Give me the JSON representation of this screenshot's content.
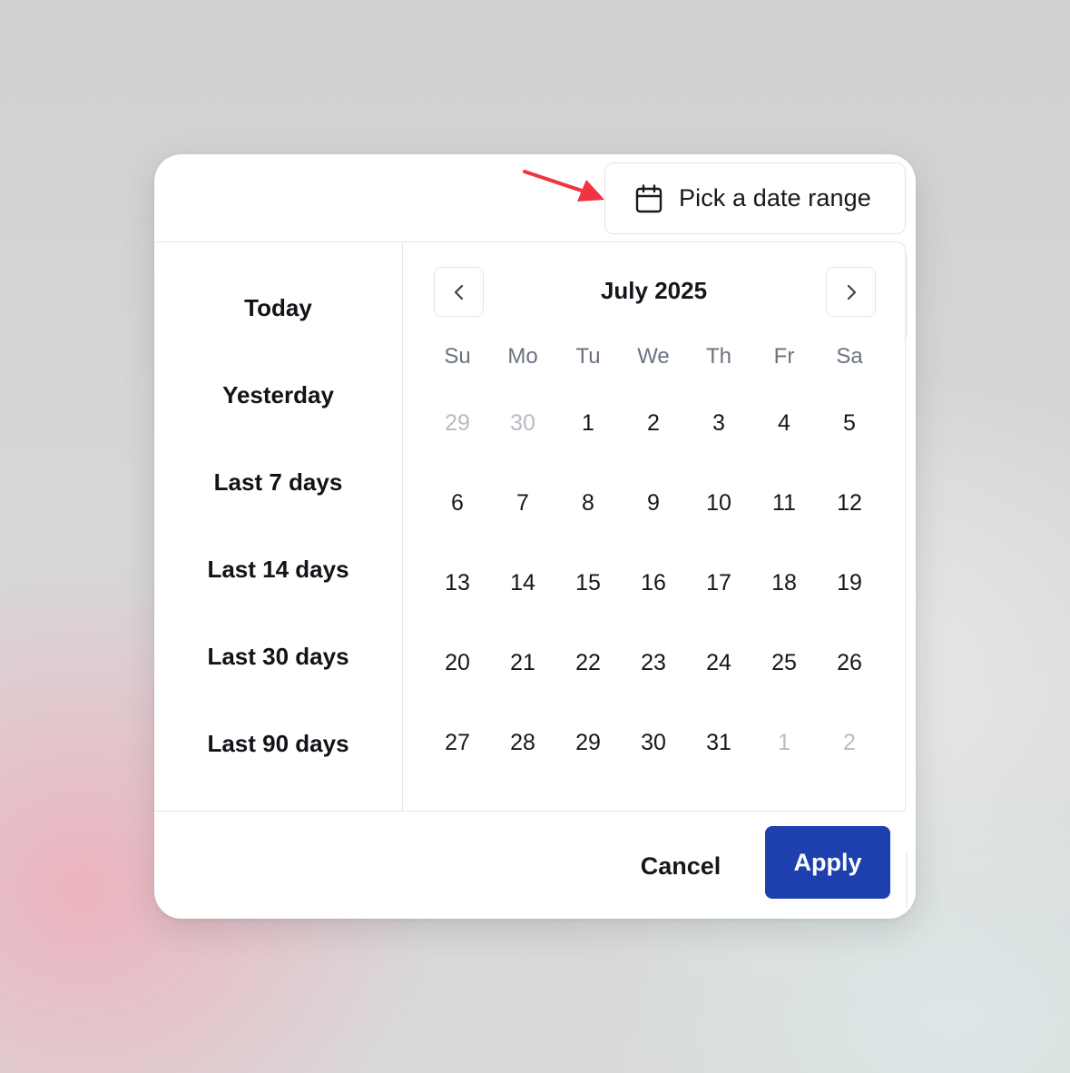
{
  "trigger": {
    "label": "Pick a date range",
    "icon": "calendar-icon"
  },
  "annotation": {
    "arrow_color": "#ef3340"
  },
  "presets": [
    "Today",
    "Yesterday",
    "Last 7 days",
    "Last 14 days",
    "Last 30 days",
    "Last 90 days"
  ],
  "calendar": {
    "month_label": "July 2025",
    "prev_icon": "chevron-left-icon",
    "next_icon": "chevron-right-icon",
    "weekdays": [
      "Su",
      "Mo",
      "Tu",
      "We",
      "Th",
      "Fr",
      "Sa"
    ],
    "weeks": [
      [
        {
          "d": "29",
          "muted": true
        },
        {
          "d": "30",
          "muted": true
        },
        {
          "d": "1"
        },
        {
          "d": "2"
        },
        {
          "d": "3"
        },
        {
          "d": "4"
        },
        {
          "d": "5"
        }
      ],
      [
        {
          "d": "6"
        },
        {
          "d": "7"
        },
        {
          "d": "8"
        },
        {
          "d": "9"
        },
        {
          "d": "10"
        },
        {
          "d": "11"
        },
        {
          "d": "12"
        }
      ],
      [
        {
          "d": "13"
        },
        {
          "d": "14"
        },
        {
          "d": "15"
        },
        {
          "d": "16"
        },
        {
          "d": "17"
        },
        {
          "d": "18"
        },
        {
          "d": "19"
        }
      ],
      [
        {
          "d": "20"
        },
        {
          "d": "21"
        },
        {
          "d": "22"
        },
        {
          "d": "23"
        },
        {
          "d": "24"
        },
        {
          "d": "25"
        },
        {
          "d": "26"
        }
      ],
      [
        {
          "d": "27"
        },
        {
          "d": "28"
        },
        {
          "d": "29"
        },
        {
          "d": "30"
        },
        {
          "d": "31"
        },
        {
          "d": "1",
          "muted": true
        },
        {
          "d": "2",
          "muted": true
        }
      ]
    ]
  },
  "footer": {
    "cancel_label": "Cancel",
    "apply_label": "Apply",
    "accent": "#1e40af"
  }
}
